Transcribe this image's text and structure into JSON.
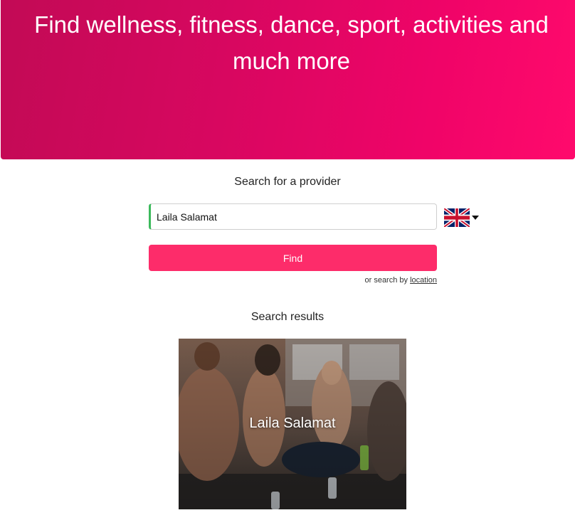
{
  "hero": {
    "title": "Find wellness, fitness, dance, sport, activities and much more"
  },
  "search": {
    "label": "Search for a provider",
    "input_value": "Laila Salamat",
    "find_label": "Find",
    "alt_prefix": "or search by ",
    "alt_link": "location"
  },
  "language": {
    "selected_icon": "uk-flag-icon"
  },
  "results": {
    "title": "Search results",
    "items": [
      {
        "name": "Laila Salamat",
        "image_icon": "fitness-class-photo"
      }
    ]
  },
  "colors": {
    "brand": "#e8066a",
    "button": "#fd2c6a",
    "input_focus": "#3cb95c"
  }
}
